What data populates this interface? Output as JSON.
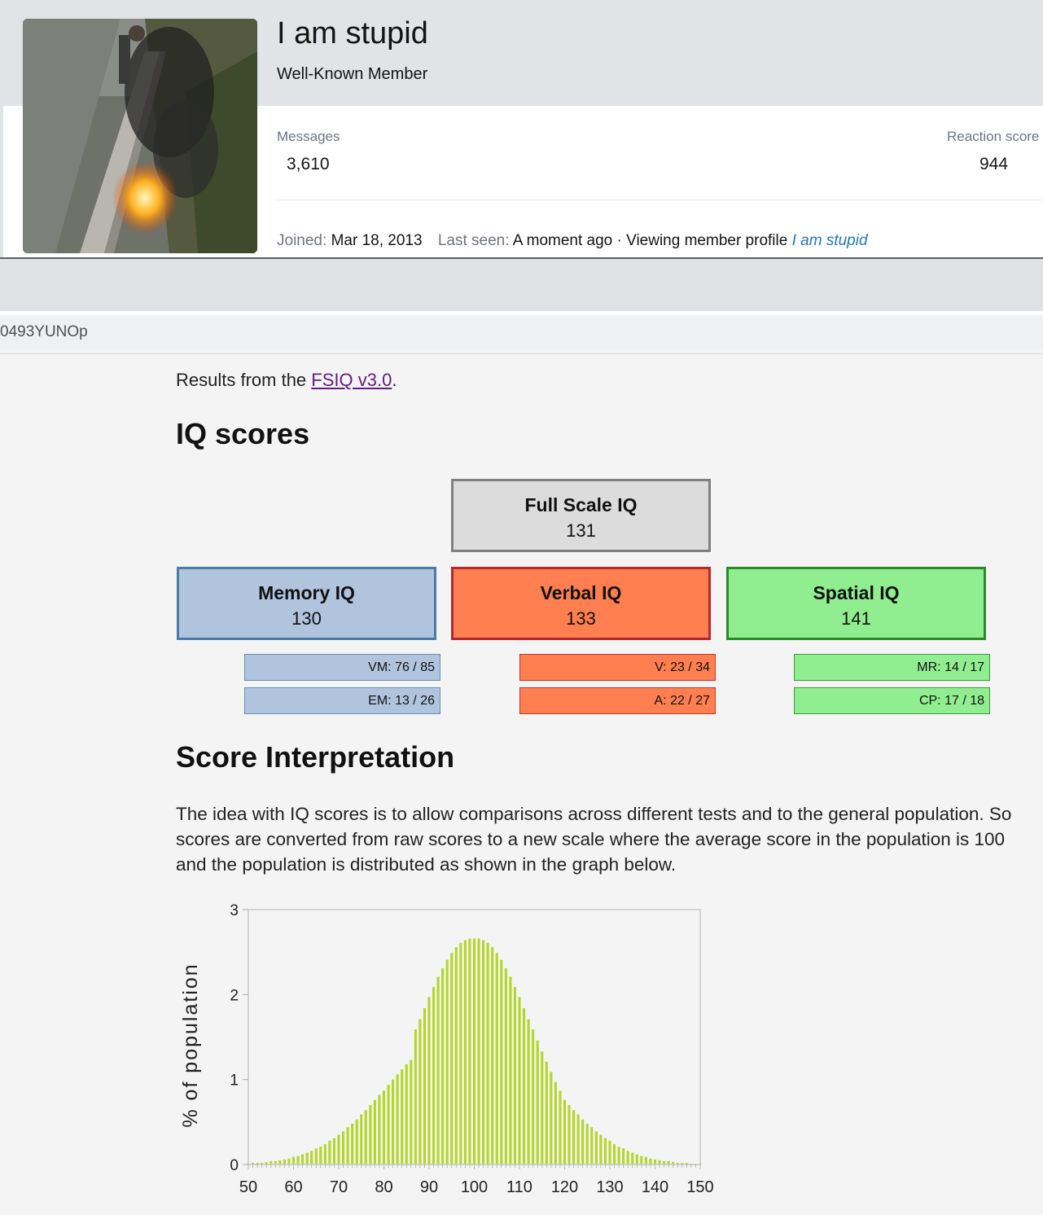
{
  "profile": {
    "username": "I am stupid",
    "title": "Well-Known Member",
    "messages_label": "Messages",
    "messages_value": "3,610",
    "reaction_label": "Reaction score",
    "reaction_value": "944",
    "joined_label": "Joined:",
    "joined_value": "Mar 18, 2013",
    "last_seen_label": "Last seen:",
    "last_seen_value": "A moment ago · Viewing member profile",
    "last_seen_link": "I am stupid"
  },
  "code_text": "0493YUNOp",
  "results": {
    "prefix": "Results from the",
    "link": "FSIQ v3.0",
    "suffix": "."
  },
  "iq_heading": "IQ scores",
  "scores": {
    "full": {
      "name": "Full Scale IQ",
      "value": "131"
    },
    "memory": {
      "name": "Memory IQ",
      "value": "130"
    },
    "verbal": {
      "name": "Verbal IQ",
      "value": "133"
    },
    "spatial": {
      "name": "Spatial IQ",
      "value": "141"
    }
  },
  "subscores": {
    "vm": "VM: 76 / 85",
    "em": "EM: 13 / 26",
    "v": "V: 23 / 34",
    "a": "A: 22 / 27",
    "mr": "MR: 14 / 17",
    "cp": "CP: 17 / 18"
  },
  "interpretation": {
    "heading": "Score Interpretation",
    "text": "The idea with IQ scores is to allow comparisons across different tests and to the general population. So scores are converted from raw scores to a new scale where the average score in the population is 100 and the population is distributed as shown in the graph below."
  },
  "colors": {
    "memory": "#b0c4de",
    "verbal": "#ff7f50",
    "spatial": "#90ee90",
    "full": "#dcdcdc",
    "bars": "#b5d629",
    "link": "#2577b1"
  },
  "chart_data": {
    "type": "bar",
    "title": "",
    "xlabel": "",
    "ylabel": "% of population",
    "xlim": [
      50,
      150
    ],
    "ylim": [
      0,
      3
    ],
    "x_ticks": [
      50,
      60,
      70,
      80,
      90,
      100,
      110,
      120,
      130,
      140,
      150
    ],
    "y_ticks": [
      0,
      1,
      2,
      3
    ],
    "distribution": {
      "mean": 100,
      "sd": 15
    },
    "x": [
      50,
      51,
      52,
      53,
      54,
      55,
      56,
      57,
      58,
      59,
      60,
      61,
      62,
      63,
      64,
      65,
      66,
      67,
      68,
      69,
      70,
      71,
      72,
      73,
      74,
      75,
      76,
      77,
      78,
      79,
      80,
      81,
      82,
      83,
      84,
      85,
      86,
      87,
      88,
      89,
      90,
      91,
      92,
      93,
      94,
      95,
      96,
      97,
      98,
      99,
      100,
      101,
      102,
      103,
      104,
      105,
      106,
      107,
      108,
      109,
      110,
      111,
      112,
      113,
      114,
      115,
      116,
      117,
      118,
      119,
      120,
      121,
      122,
      123,
      124,
      125,
      126,
      127,
      128,
      129,
      130,
      131,
      132,
      133,
      134,
      135,
      136,
      137,
      138,
      139,
      140,
      141,
      142,
      143,
      144,
      145,
      146,
      147,
      148,
      149,
      150
    ],
    "values": [
      0.01,
      0.02,
      0.02,
      0.02,
      0.03,
      0.04,
      0.04,
      0.05,
      0.06,
      0.07,
      0.09,
      0.1,
      0.12,
      0.14,
      0.16,
      0.19,
      0.21,
      0.24,
      0.28,
      0.31,
      0.35,
      0.39,
      0.44,
      0.48,
      0.53,
      0.59,
      0.64,
      0.7,
      0.76,
      0.82,
      0.87,
      0.94,
      1.0,
      1.06,
      1.12,
      1.18,
      1.23,
      1.59,
      1.71,
      1.84,
      1.97,
      2.09,
      2.21,
      2.31,
      2.41,
      2.49,
      2.56,
      2.61,
      2.64,
      2.66,
      2.66,
      2.66,
      2.64,
      2.61,
      2.56,
      2.49,
      2.41,
      2.31,
      2.21,
      2.09,
      1.97,
      1.84,
      1.71,
      1.59,
      1.46,
      1.33,
      1.21,
      1.09,
      0.97,
      0.87,
      0.76,
      0.7,
      0.64,
      0.59,
      0.53,
      0.48,
      0.44,
      0.39,
      0.35,
      0.31,
      0.28,
      0.24,
      0.21,
      0.19,
      0.16,
      0.14,
      0.12,
      0.1,
      0.09,
      0.07,
      0.06,
      0.05,
      0.04,
      0.04,
      0.03,
      0.02,
      0.02,
      0.02,
      0.01,
      0.01,
      0.01
    ]
  }
}
